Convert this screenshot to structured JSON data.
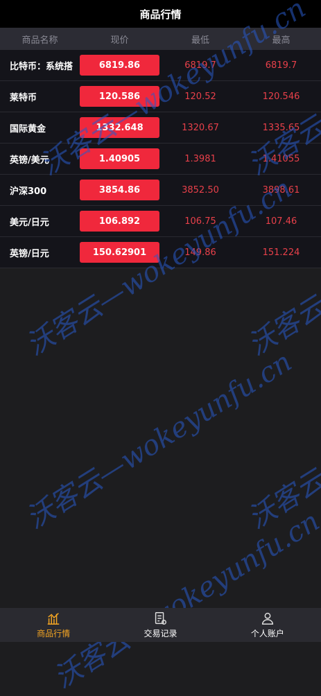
{
  "header": {
    "title": "商品行情"
  },
  "columns": {
    "name": "商品名称",
    "price": "现价",
    "low": "最低",
    "high": "最高"
  },
  "rows": [
    {
      "name": "比特币：系统搭",
      "price": "6819.86",
      "low": "6819.7",
      "high": "6819.7"
    },
    {
      "name": "莱特币",
      "price": "120.586",
      "low": "120.52",
      "high": "120.546"
    },
    {
      "name": "国际黄金",
      "price": "1332.648",
      "low": "1320.67",
      "high": "1335.65"
    },
    {
      "name": "英镑/美元",
      "price": "1.40905",
      "low": "1.3981",
      "high": "1.41055"
    },
    {
      "name": "沪深300",
      "price": "3854.86",
      "low": "3852.50",
      "high": "3898.61"
    },
    {
      "name": "美元/日元",
      "price": "106.892",
      "low": "106.75",
      "high": "107.46"
    },
    {
      "name": "英镑/日元",
      "price": "150.62901",
      "low": "149.86",
      "high": "151.224"
    }
  ],
  "watermark": {
    "text": "沃客云—wokeyunfu.cn",
    "color": "#285ac8"
  },
  "tabs": [
    {
      "label": "商品行情",
      "icon": "chart-icon",
      "active": true
    },
    {
      "label": "交易记录",
      "icon": "receipt-icon",
      "active": false
    },
    {
      "label": "个人账户",
      "icon": "user-icon",
      "active": false
    }
  ],
  "colors": {
    "accent": "#f0283c",
    "active_tab": "#f5a623",
    "down": "#e8404a"
  }
}
